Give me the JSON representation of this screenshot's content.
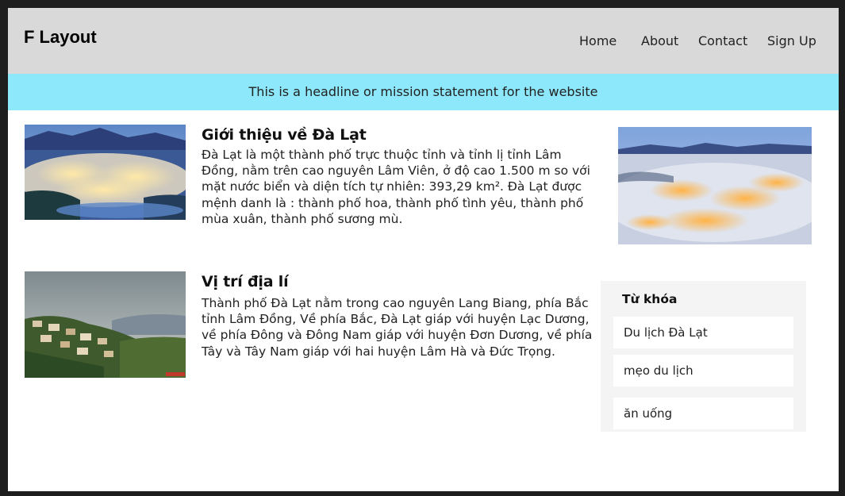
{
  "header": {
    "logo": "F Layout",
    "nav": [
      {
        "label": "Home"
      },
      {
        "label": "About"
      },
      {
        "label": "Contact"
      },
      {
        "label": "Sign Up"
      }
    ]
  },
  "banner": {
    "text": "This is a headline or mission statement for the website"
  },
  "articles": [
    {
      "title": "Giới thiệu về Đà Lạt",
      "lines": [
        "Đà Lạt là một thành phố trực thuộc tỉnh và tỉnh lị tỉnh Lâm",
        "Đồng, nằm trên cao nguyên Lâm Viên, ở độ cao 1.500 m so với",
        "mặt nước biển và diện tích tự nhiên: 393,29 km². Đà Lạt được",
        "mệnh danh là : thành phố hoa, thành phố tình yêu, thành phố",
        "mùa xuân, thành phố sương mù."
      ]
    },
    {
      "title": "Vị trí địa lí",
      "lines": [
        "Thành phố Đà Lạt nằm trong cao nguyên Lang Biang, phía Bắc",
        "tỉnh Lâm Đồng, Về phía Bắc, Đà Lạt giáp với huyện Lạc Dương,",
        "về phía Đông và Đông Nam giáp với huyện Đơn Dương, về phía",
        "Tây và Tây Nam giáp với hai huyện Lâm Hà và Đức Trọng."
      ]
    }
  ],
  "keywords": {
    "title": "Từ khóa",
    "items": [
      "Du lịch Đà Lạt",
      "mẹo du lịch",
      "ăn uống"
    ]
  },
  "colors": {
    "header_bg": "#d9d9d9",
    "banner_bg": "#8ee8fb",
    "panel_bg": "#f4f4f4"
  }
}
